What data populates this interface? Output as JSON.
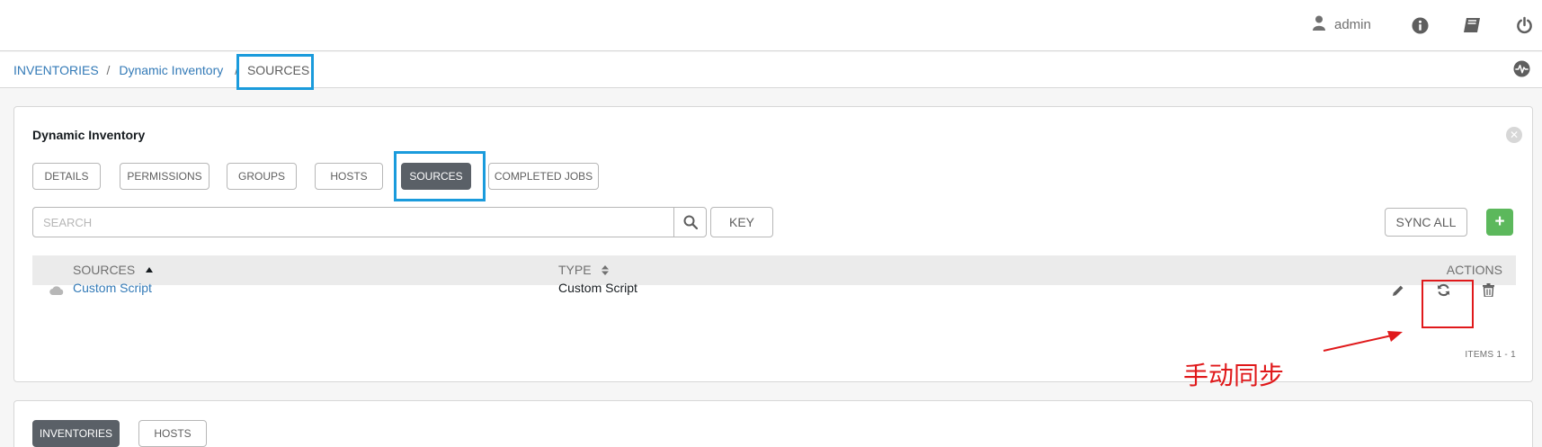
{
  "header": {
    "user_name": "admin",
    "icons": [
      "user-icon",
      "info-icon",
      "book-icon",
      "power-icon"
    ]
  },
  "breadcrumb": {
    "items": [
      "INVENTORIES",
      "Dynamic Inventory",
      "SOURCES"
    ],
    "separator": "/",
    "activity_icon": "activity-stream-icon"
  },
  "inventory_panel": {
    "title": "Dynamic Inventory",
    "tabs": [
      "DETAILS",
      "PERMISSIONS",
      "GROUPS",
      "HOSTS",
      "SOURCES",
      "COMPLETED JOBS"
    ],
    "active_tab": "SOURCES",
    "search": {
      "placeholder": "SEARCH"
    },
    "key_label": "KEY",
    "sync_all_label": "SYNC ALL",
    "add_label": "+",
    "table": {
      "columns": [
        "SOURCES",
        "TYPE",
        "ACTIONS"
      ],
      "rows": [
        {
          "name": "Custom Script",
          "type": "Custom Script",
          "status_icon": "cloud-icon"
        }
      ]
    },
    "actions": [
      "edit-icon",
      "sync-icon",
      "delete-icon"
    ],
    "items_label": "ITEMS  1 - 1"
  },
  "annotation": {
    "text": "手动同步",
    "color": "#e0191b"
  },
  "bottom_panel": {
    "tabs": [
      "INVENTORIES",
      "HOSTS"
    ],
    "active_tab": "INVENTORIES"
  },
  "colors": {
    "highlight_blue": "#1a9bdc",
    "highlight_red": "#e0191b",
    "link": "#337ab7",
    "add_button": "#5cb85c",
    "active_tab": "#5a6067"
  }
}
